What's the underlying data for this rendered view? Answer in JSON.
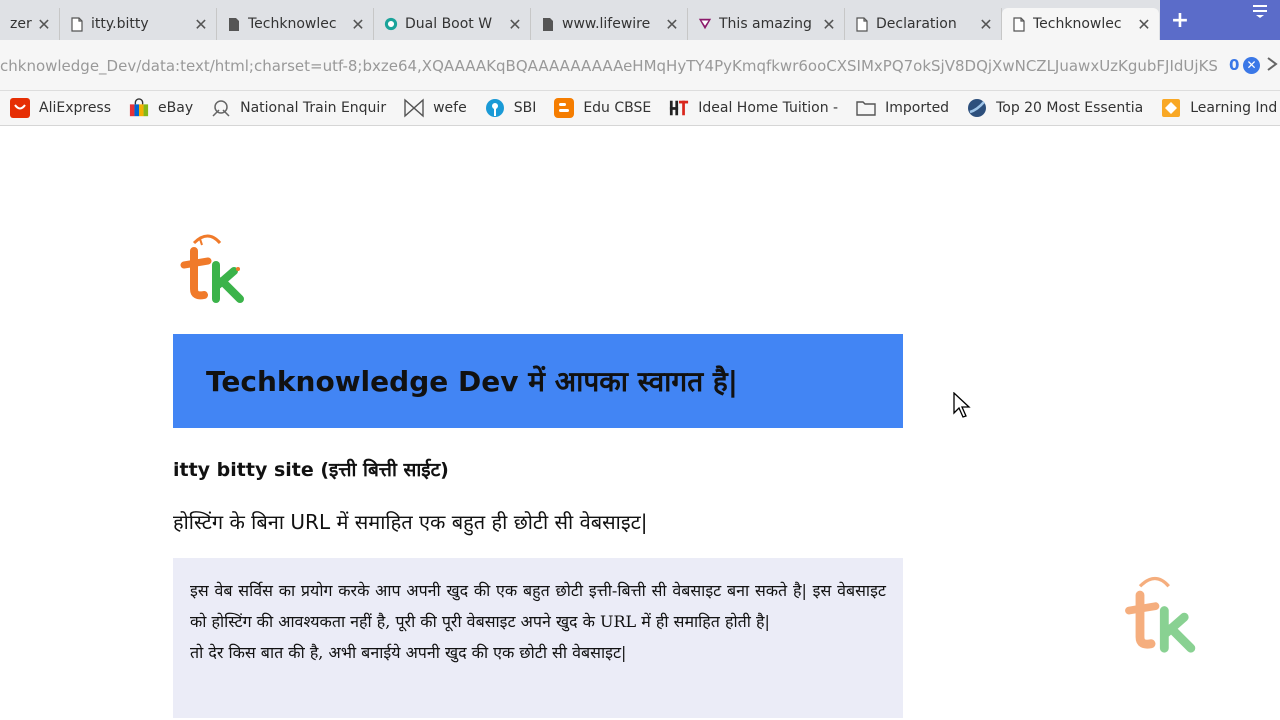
{
  "tabs": [
    {
      "title": "zer",
      "icon": "document-icon",
      "active": false
    },
    {
      "title": "itty.bitty",
      "icon": "document-icon",
      "active": false
    },
    {
      "title": "Techknowlec",
      "icon": "document-icon",
      "active": false
    },
    {
      "title": "Dual Boot W",
      "icon": "teal-globe-icon",
      "active": false
    },
    {
      "title": "www.lifewire",
      "icon": "document-icon",
      "active": false
    },
    {
      "title": "This amazing",
      "icon": "v-logo-icon",
      "active": false
    },
    {
      "title": "Declaration",
      "icon": "document-icon",
      "active": false
    },
    {
      "title": "Techknowlec",
      "icon": "document-icon",
      "active": true
    }
  ],
  "tab_close_glyph": "✕",
  "new_tab_glyph": "+",
  "address_bar": {
    "url": "chknowledge_Dev/data:text/html;charset=utf-8;bxze64,XQAAAAKqBQAAAAAAAAAeHMqHyTY4PyKmqfkwr6ooCXSIMxPQ7okSjV8DQjXwNCZLJuawxUzKgubFJIdUjKS",
    "count": "0",
    "clear_glyph": "✕"
  },
  "bookmarks": [
    {
      "label": "AliExpress",
      "icon": "aliexpress-icon"
    },
    {
      "label": "eBay",
      "icon": "ebay-bag-icon"
    },
    {
      "label": "National Train Enquir",
      "icon": "train-icon"
    },
    {
      "label": "wefe",
      "icon": "bowtie-icon"
    },
    {
      "label": "SBI",
      "icon": "sbi-icon"
    },
    {
      "label": "Edu CBSE",
      "icon": "blogger-icon"
    },
    {
      "label": "Ideal Home Tuition -",
      "icon": "ht-logo-icon"
    },
    {
      "label": "Imported",
      "icon": "folder-icon"
    },
    {
      "label": "Top 20 Most Essentia",
      "icon": "globe-icon"
    },
    {
      "label": "Learning Ind",
      "icon": "diamond-icon"
    }
  ],
  "page": {
    "banner_title": "Techknowledge Dev में आपका स्वागत है|",
    "site_heading": "itty bitty site (इत्ती बित्ती साईट)",
    "site_subtitle": "होस्टिंग के बिना URL में समाहित एक बहुत ही छोटी सी वेबसाइट|",
    "info_paragraph_1": "इस वेब सर्विस का प्रयोग करके आप अपनी खुद की एक बहुत छोटी इत्ती-बित्ती सी वेबसाइट बना सकते है| इस वेबसाइट को होस्टिंग की आवश्यकता नहीं है, पूरी की पूरी वेबसाइट अपने खुद के URL में ही समाहित होती है|",
    "info_paragraph_2": "तो देर किस बात की है, अभी बनाईये अपनी खुद की एक छोटी सी वेबसाइट|"
  },
  "colors": {
    "banner_bg": "#4285f4",
    "info_box_bg": "#ebecf7",
    "accent_blue": "#3b78e7",
    "logo_orange": "#f07a2a",
    "logo_green": "#3bb34a"
  }
}
